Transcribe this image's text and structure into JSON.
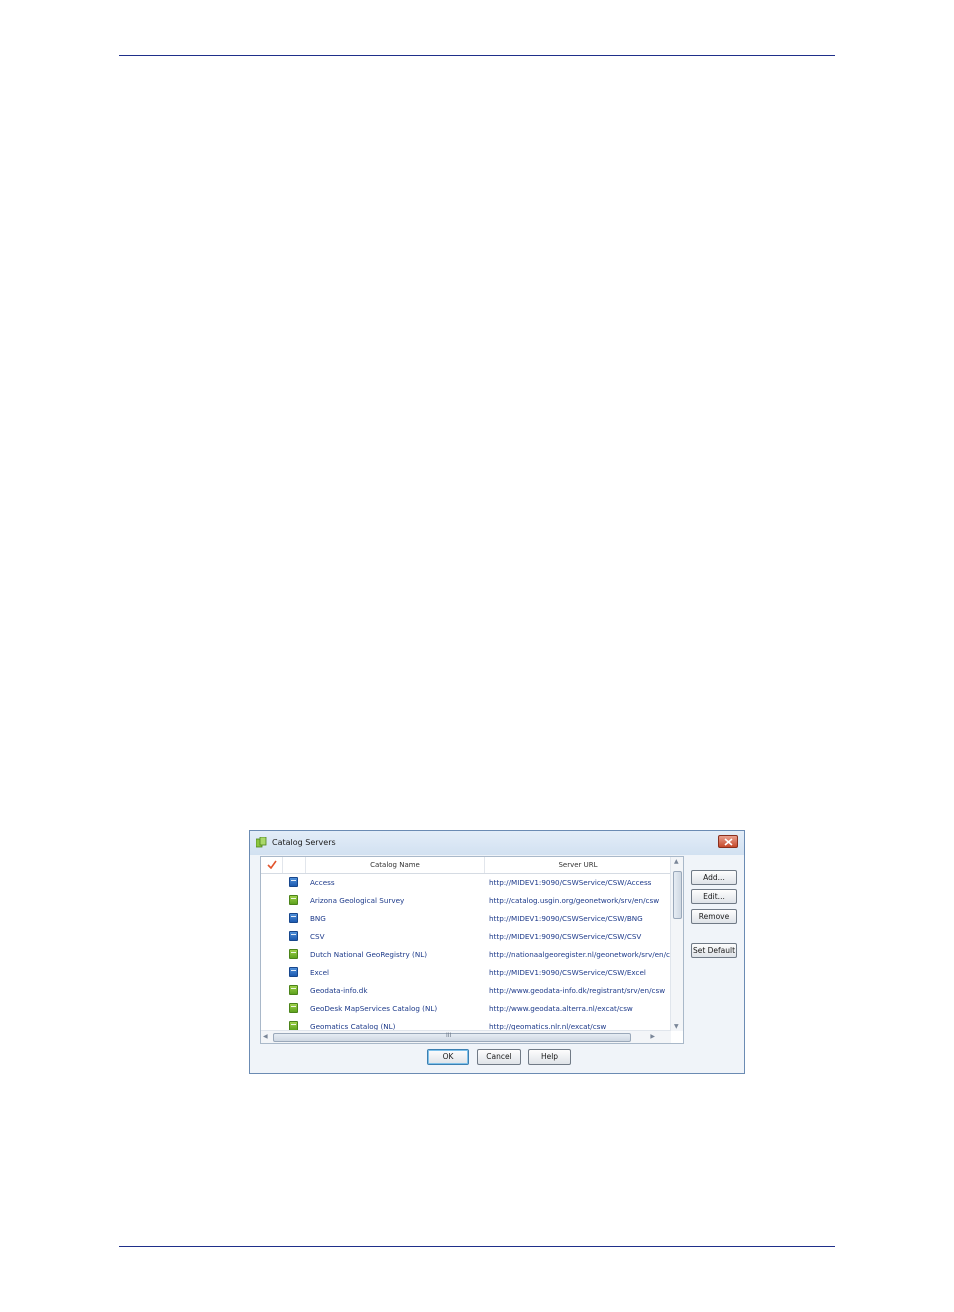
{
  "dialog": {
    "title": "Catalog Servers",
    "columns": {
      "check": "✓",
      "name": "Catalog Name",
      "url": "Server URL"
    },
    "rows": [
      {
        "icon": "blue",
        "name": "Access",
        "url": "http://MIDEV1:9090/CSWService/CSW/Access"
      },
      {
        "icon": "green",
        "name": "Arizona Geological Survey",
        "url": "http://catalog.usgin.org/geonetwork/srv/en/csw"
      },
      {
        "icon": "blue",
        "name": "BNG",
        "url": "http://MIDEV1:9090/CSWService/CSW/BNG"
      },
      {
        "icon": "blue",
        "name": "CSV",
        "url": "http://MIDEV1:9090/CSWService/CSW/CSV"
      },
      {
        "icon": "green",
        "name": "Dutch National GeoRegistry (NL)",
        "url": "http://nationaalgeoregister.nl/geonetwork/srv/en/csw"
      },
      {
        "icon": "blue",
        "name": "Excel",
        "url": "http://MIDEV1:9090/CSWService/CSW/Excel"
      },
      {
        "icon": "green",
        "name": "Geodata-info.dk",
        "url": "http://www.geodata-info.dk/registrant/srv/en/csw"
      },
      {
        "icon": "green",
        "name": "GeoDesk MapServices Catalog (NL)",
        "url": "http://www.geodata.alterra.nl/excat/csw"
      },
      {
        "icon": "green",
        "name": "Geomatics Catalog (NL)",
        "url": "http://geomatics.nlr.nl/excat/csw"
      }
    ],
    "side_buttons": {
      "add": "Add...",
      "edit": "Edit...",
      "remove": "Remove",
      "set_default": "Set Default"
    },
    "footer_buttons": {
      "ok": "OK",
      "cancel": "Cancel",
      "help": "Help"
    },
    "hscroll_label": "III"
  }
}
